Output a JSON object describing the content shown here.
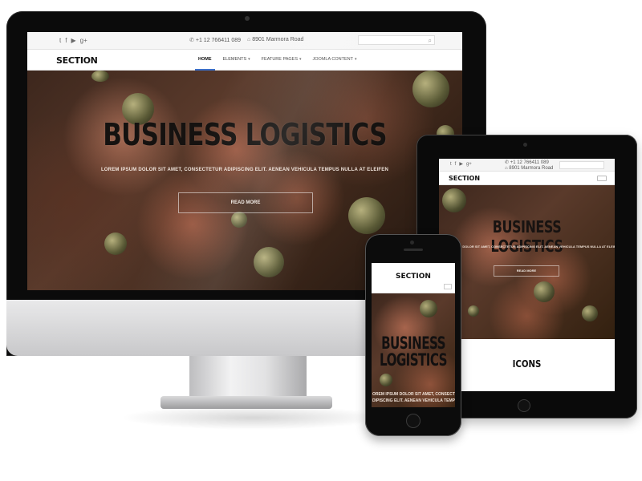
{
  "desktop": {
    "topbar": {
      "social_icons": [
        "twitter-icon",
        "facebook-icon",
        "youtube-icon",
        "google-plus-icon"
      ],
      "social_glyphs": [
        "t",
        "f",
        "▶",
        "g+"
      ],
      "phone": "+1 12 766411 089",
      "address": "8901 Marmora Road"
    },
    "nav": {
      "logo": "SECTION",
      "items": [
        {
          "label": "HOME",
          "active": true
        },
        {
          "label": "ELEMENTS",
          "dropdown": true
        },
        {
          "label": "FEATURE PAGES",
          "dropdown": true
        },
        {
          "label": "JOOMLA CONTENT",
          "dropdown": true
        }
      ]
    },
    "hero": {
      "title": "BUSINESS LOGISTICS",
      "subtitle": "LOREM IPSUM DOLOR SIT AMET, CONSECTETUR ADIPISCING ELIT. AENEAN VEHICULA TEMPUS NULLA AT ELEIFEN",
      "button": "READ MORE"
    }
  },
  "tablet": {
    "topbar": {
      "phone": "+1 12 766411 089",
      "address": "8901 Marmora Road"
    },
    "logo": "SECTION",
    "hero": {
      "title": "BUSINESS LOGISTICS",
      "subtitle": "LOREM IPSUM DOLOR SIT AMET, CONSECTETUR ADIPISCING ELIT. AENEAN VEHICULA TEMPUS NULLA AT ELEIFEN",
      "button": "READ MORE"
    },
    "section_title": "ICONS"
  },
  "phone": {
    "logo": "SECTION",
    "hero": {
      "title_line1": "BUSINESS",
      "title_line2": "LOGISTICS",
      "subtitle_line1": "OREM IPSUM DOLOR SIT AMET, CONSECTE",
      "subtitle_line2": "DIPISCING ELIT. AENEAN VEHICULA TEMP"
    }
  },
  "colors": {
    "accent": "#3c6fc9",
    "hero_text": "#151210",
    "device_frame": "#0b0b0b"
  }
}
